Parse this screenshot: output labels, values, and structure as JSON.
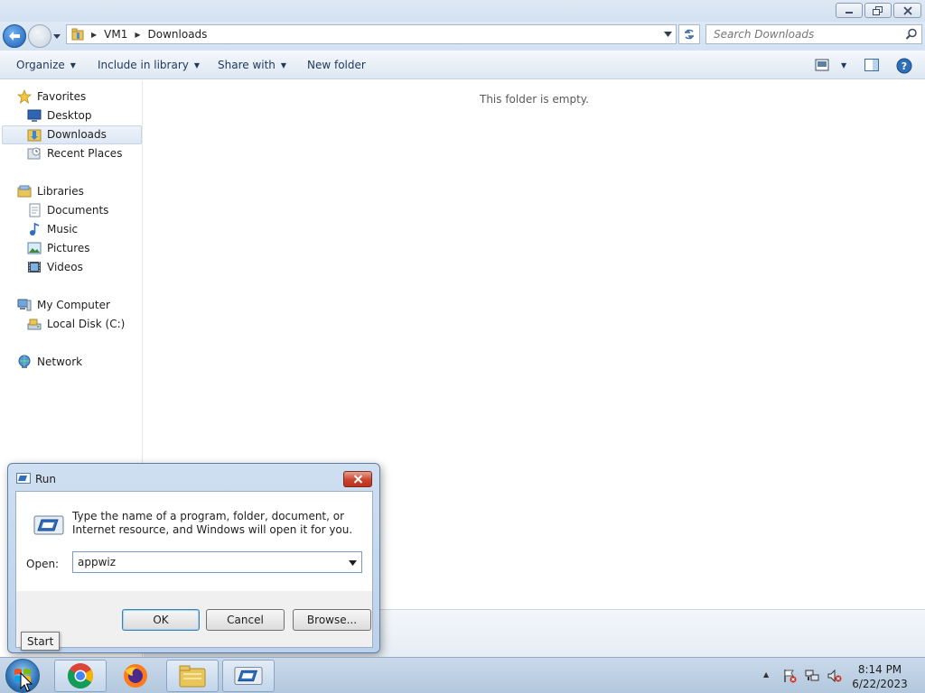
{
  "window": {
    "breadcrumb": [
      "VM1",
      "Downloads"
    ],
    "search_placeholder": "Search Downloads"
  },
  "commands": {
    "organize": "Organize",
    "include_in_library": "Include in library",
    "share_with": "Share with",
    "new_folder": "New folder"
  },
  "nav": {
    "favorites": "Favorites",
    "desktop": "Desktop",
    "downloads": "Downloads",
    "recent_places": "Recent Places",
    "libraries": "Libraries",
    "documents": "Documents",
    "music": "Music",
    "pictures": "Pictures",
    "videos": "Videos",
    "my_computer": "My Computer",
    "local_disk": "Local Disk (C:)",
    "network": "Network"
  },
  "content": {
    "empty_message": "This folder is empty."
  },
  "run_dialog": {
    "title": "Run",
    "description": "Type the name of a program, folder, document, or Internet resource, and Windows will open it for you.",
    "open_label": "Open:",
    "open_value": "appwiz",
    "ok_label": "OK",
    "cancel_label": "Cancel",
    "browse_label": "Browse..."
  },
  "taskbar": {
    "tooltip": "Start",
    "time": "8:14 PM",
    "date": "6/22/2023",
    "apps": [
      "chrome-icon",
      "firefox-icon",
      "file-explorer-icon",
      "run-icon"
    ]
  },
  "colors": {
    "accent": "#1d5fb8",
    "close_red": "#c9432d"
  }
}
